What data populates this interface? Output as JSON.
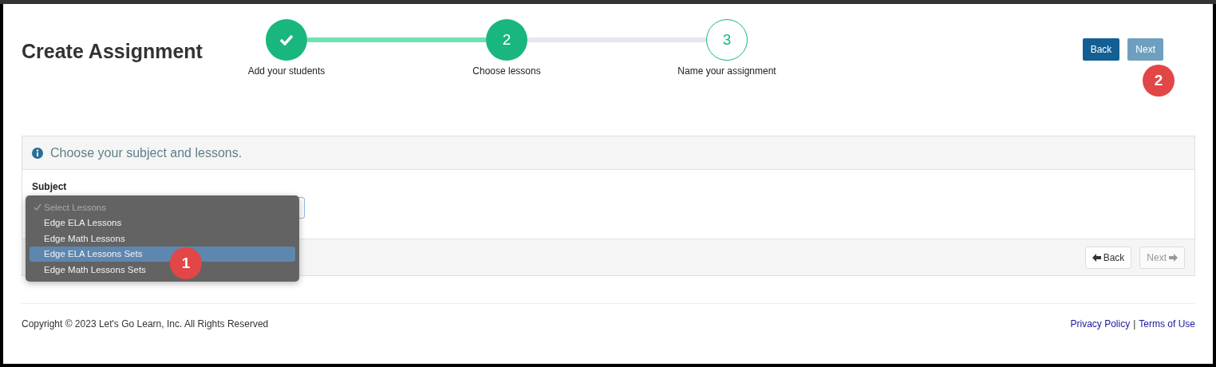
{
  "title": "Create Assignment",
  "steps": [
    {
      "completed": true,
      "reached": true,
      "label": "Add your students"
    },
    {
      "completed": false,
      "reached": true,
      "number": "2",
      "label": "Choose lessons"
    },
    {
      "completed": false,
      "reached": false,
      "number": "3",
      "label": "Name your assignment"
    }
  ],
  "top_buttons": [
    {
      "label": "Back",
      "disabled": false
    },
    {
      "label": "Next",
      "disabled": true
    }
  ],
  "panel": {
    "heading": "Choose your subject and lessons.",
    "field_label": "Subject",
    "footer_buttons": [
      {
        "label": "Back",
        "disabled": false
      },
      {
        "label": "Next",
        "disabled": true
      }
    ]
  },
  "dropdown": {
    "options": [
      {
        "label": "Select Lessons",
        "checked": true,
        "highlighted": false
      },
      {
        "label": "Edge ELA Lessons",
        "checked": false,
        "highlighted": false
      },
      {
        "label": "Edge Math Lessons",
        "checked": false,
        "highlighted": false
      },
      {
        "label": "Edge ELA Lessons Sets",
        "checked": false,
        "highlighted": true
      },
      {
        "label": "Edge Math Lessons Sets",
        "checked": false,
        "highlighted": false
      }
    ]
  },
  "callouts": [
    "1",
    "2"
  ],
  "footer": {
    "copyright": "Copyright © 2023 Let's Go Learn, Inc. All Rights Reserved",
    "links": [
      "Privacy Policy",
      "Terms of Use"
    ],
    "separator": "|"
  }
}
